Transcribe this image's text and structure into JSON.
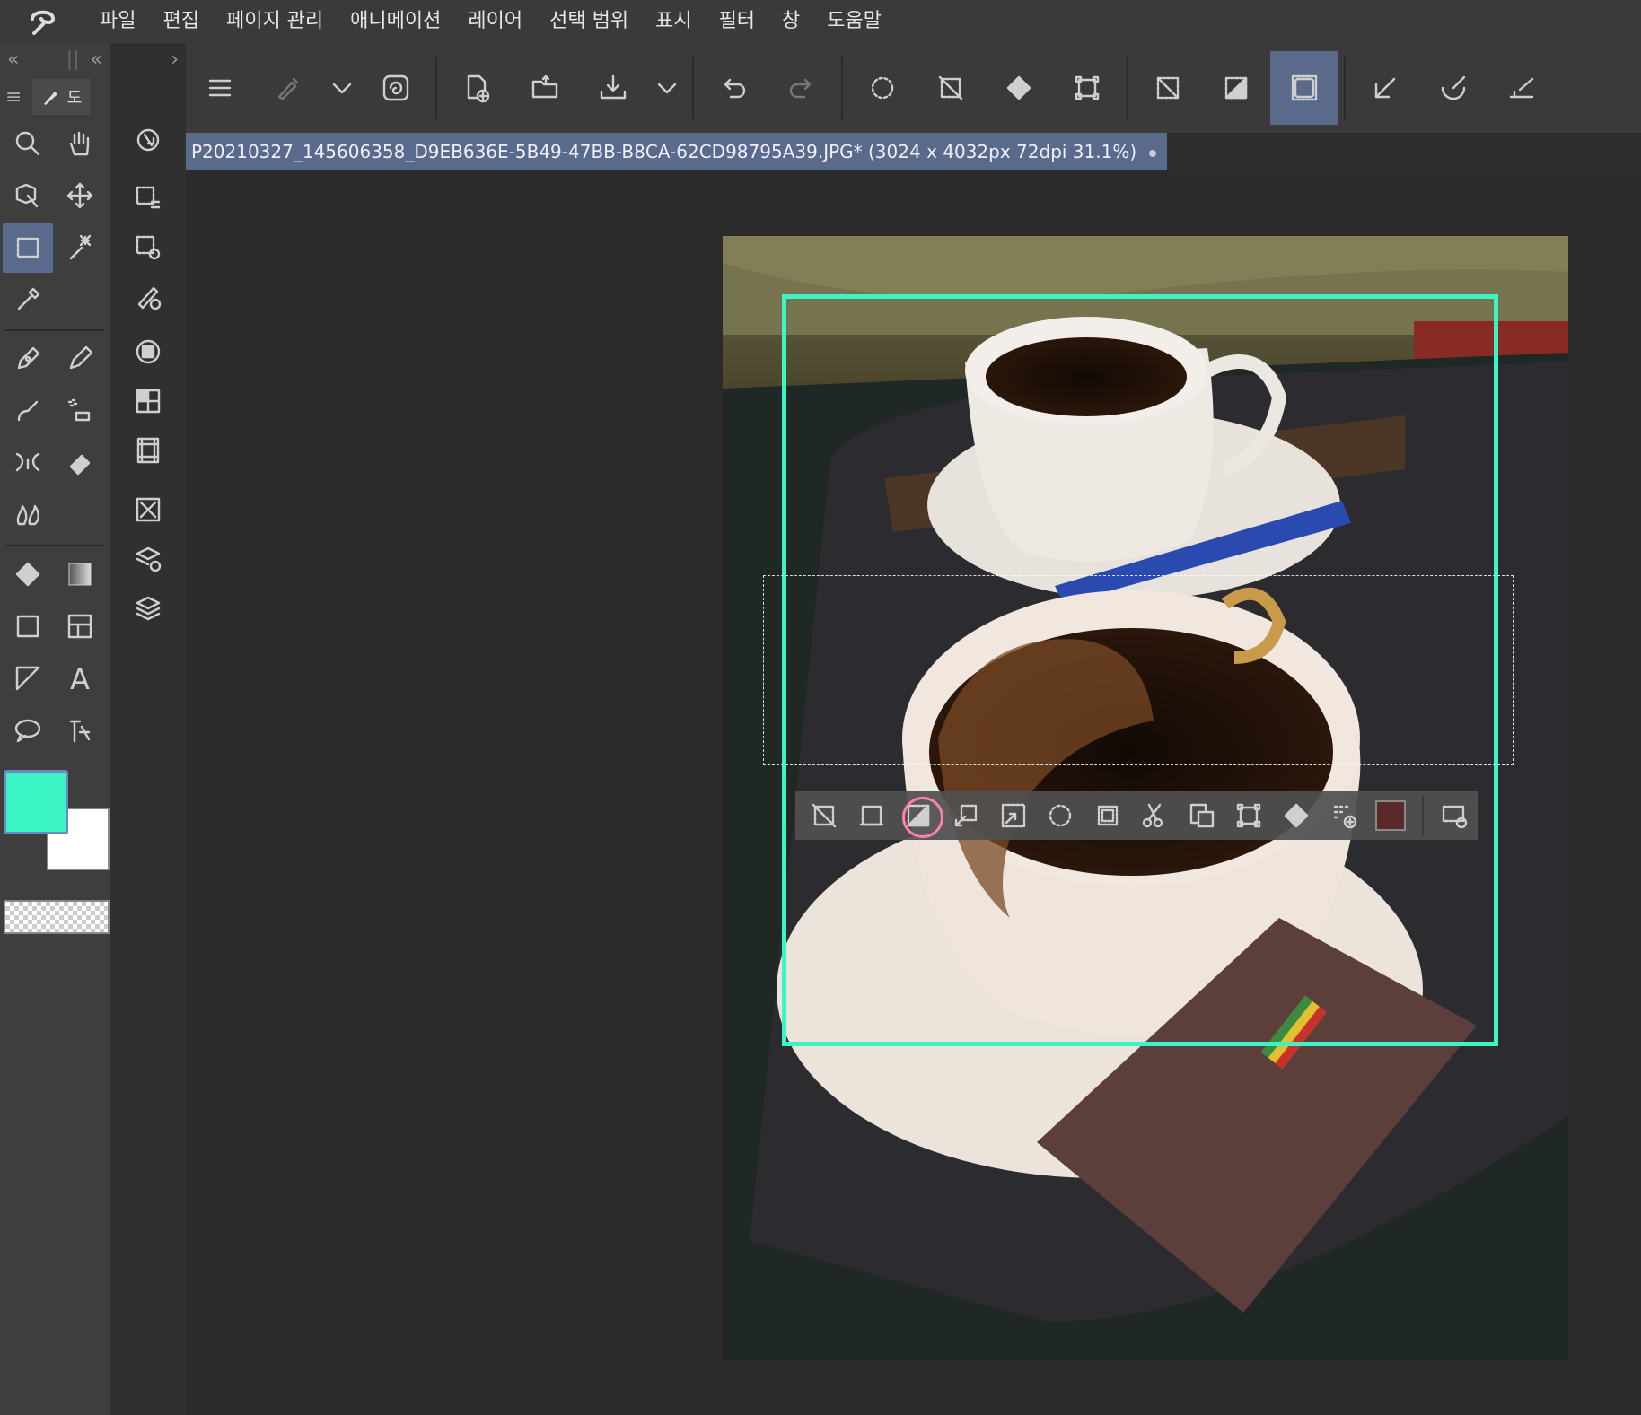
{
  "app": {
    "logo_icon": "clip-studio-logo-icon"
  },
  "menu": [
    {
      "label": "파일"
    },
    {
      "label": "편집"
    },
    {
      "label": "페이지 관리"
    },
    {
      "label": "애니메이션"
    },
    {
      "label": "레이어"
    },
    {
      "label": "선택 범위"
    },
    {
      "label": "표시"
    },
    {
      "label": "필터"
    },
    {
      "label": "창"
    },
    {
      "label": "도움말"
    }
  ],
  "toolbar": {
    "icons": [
      "menu-icon",
      "brush-settings-icon",
      "chevron-down-icon",
      "clip-studio-icon",
      "new-document-icon",
      "open-folder-icon",
      "save-icon",
      "chevron-down-icon",
      "undo-icon",
      "redo-icon",
      "select-all-icon",
      "deselect-icon",
      "fill-icon",
      "transform-icon",
      "clear-selection-icon",
      "invert-selection-icon",
      "show-selection-icon",
      "ruler-snap-icon",
      "special-ruler-icon",
      "grid-snap-icon"
    ],
    "active": "show-selection-icon"
  },
  "left_panel": {
    "collapse_left": "«",
    "collapse_mid": "«",
    "expand_right": "›",
    "tab_label": "도"
  },
  "document": {
    "tab_title": "P20210327_145606358_D9EB636E-5B49-47BB-B8CA-62CD98795A39.JPG* (3024 x 4032px 72dpi 31.1%)"
  },
  "colors": {
    "main": "#3cf5c6",
    "sub": "#ffffff",
    "frame": "#3cf5c6",
    "swatch_in_bar": "#5a2a2a"
  },
  "selection_launcher": {
    "icons": [
      "deselect-icon",
      "crop-icon",
      "invert-selection-icon",
      "expand-selection-icon",
      "shrink-selection-icon",
      "select-all-icon",
      "selection-border-icon",
      "cut-icon",
      "copy-paste-icon",
      "transform-icon",
      "fill-icon",
      "add-tone-icon",
      "color-swatch",
      "launcher-settings-icon"
    ],
    "highlighted": "invert-selection-icon"
  }
}
